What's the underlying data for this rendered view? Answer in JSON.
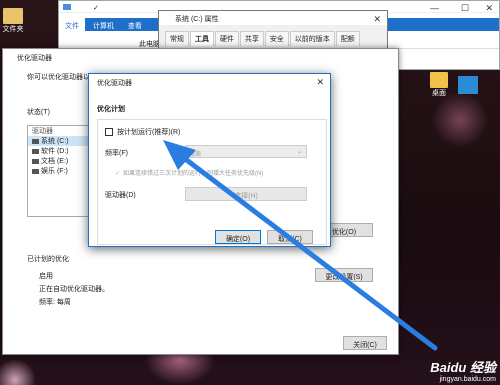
{
  "desktop": {
    "icons": [
      {
        "label": "文件夹"
      }
    ],
    "right_icon": {
      "label": "桌面"
    },
    "left_labels": [
      "你",
      "可",
      "优"
    ]
  },
  "explorer": {
    "title_checkmark": "✓",
    "tabs": [
      {
        "label": "文件",
        "selected": true
      },
      {
        "label": "计算机",
        "selected": false
      },
      {
        "label": "查看",
        "selected": false
      }
    ],
    "address": "此电脑",
    "window_controls": [
      "—",
      "☐",
      "✕"
    ]
  },
  "properties": {
    "title": "系统 (C:) 属性",
    "tabs": [
      {
        "label": "常规",
        "selected": false
      },
      {
        "label": "工具",
        "selected": true
      },
      {
        "label": "硬件",
        "selected": false
      },
      {
        "label": "共享",
        "selected": false
      },
      {
        "label": "安全",
        "selected": false
      },
      {
        "label": "以前的版本",
        "selected": false
      },
      {
        "label": "配额",
        "selected": false
      }
    ],
    "close": "✕"
  },
  "optimize": {
    "title": "优化驱动器",
    "description": "你可以优化驱动器以帮...",
    "status_label": "状态(T)",
    "list_header": "驱动器",
    "drives": [
      {
        "label": "系统 (C:)",
        "selected": true
      },
      {
        "label": "软件 (D:)",
        "selected": false
      },
      {
        "label": "文档 (E:)",
        "selected": false
      },
      {
        "label": "娱乐 (F:)",
        "selected": false
      }
    ],
    "optimize_button": "优化(O)",
    "scheduled_label": "已计划的优化",
    "scheduled_status": "启用",
    "scheduled_desc1": "正在自动优化驱动器。",
    "scheduled_desc2": "频率: 每周",
    "change_settings_button": "更改设置(S)",
    "close_button": "关闭(C)"
  },
  "schedule": {
    "title": "优化驱动器",
    "heading": "优化计划",
    "run_on_schedule": "按计划运行(推荐)(R)",
    "frequency_label": "频率(F)",
    "frequency_value": "每周",
    "increase_priority": "如果连续错过三次计划的运行，则增大任务优先级(N)",
    "drives_label": "驱动器(D)",
    "choose_button": "选择(H)",
    "ok_button": "确定(O)",
    "cancel_button": "取消(C)",
    "close": "✕"
  },
  "watermark": {
    "logo": "Baidu 经验",
    "url": "jingyan.baidu.com"
  },
  "colors": {
    "accent": "#1e6fc8",
    "arrow": "#2a7de1"
  }
}
